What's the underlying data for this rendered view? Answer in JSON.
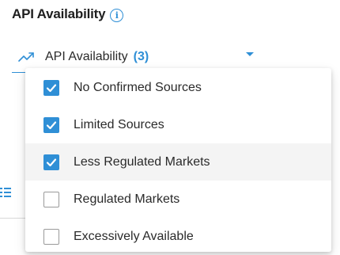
{
  "header": {
    "title": "API Availability",
    "info_icon_glyph": "i"
  },
  "select": {
    "label": "API Availability",
    "count": "(3)",
    "icon": "trending-up-icon",
    "caret_icon": "caret-down-icon"
  },
  "dropdown": {
    "options": [
      {
        "label": "No Confirmed Sources",
        "checked": true
      },
      {
        "label": "Limited Sources",
        "checked": true
      },
      {
        "label": "Less Regulated Markets",
        "checked": true,
        "hovered": true
      },
      {
        "label": "Regulated Markets",
        "checked": false
      },
      {
        "label": "Excessively Available",
        "checked": false
      }
    ]
  },
  "colors": {
    "accent": "#2f8fd6",
    "text": "#2a2a2a",
    "hover_bg": "#f4f4f4",
    "unchecked_border": "#9a9a9a"
  }
}
